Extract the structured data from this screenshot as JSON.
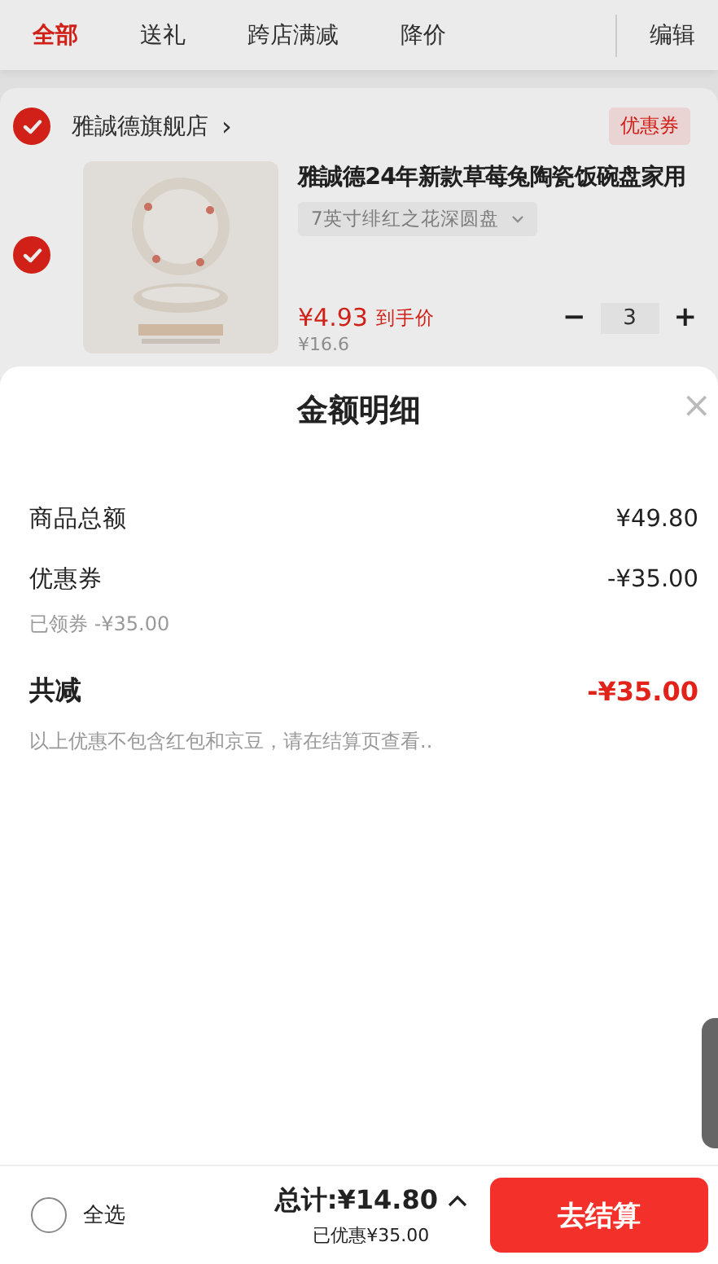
{
  "tabs": [
    {
      "label": "全部",
      "selected": true
    },
    {
      "label": "送礼",
      "selected": false
    },
    {
      "label": "跨店满减",
      "selected": false
    },
    {
      "label": "降价",
      "selected": false
    }
  ],
  "edit_button": "编辑",
  "store": {
    "name": "雅誠德旗舰店",
    "checked": true,
    "arrow": "›",
    "coupon_tag": "优惠券"
  },
  "item": {
    "checked": true,
    "title": "雅誠德24年新款草莓兔陶瓷饭碗盘家用",
    "variant": "7英寸绯红之花深圆盘",
    "price": "¥4.93",
    "price_note": "到手价",
    "original_price": "¥16.6",
    "quantity": "3",
    "minus": "−",
    "plus": "+"
  },
  "sheet": {
    "title": "金额明细",
    "close": "×",
    "rows": [
      {
        "kind": "line",
        "label": "商品总额",
        "value": "¥49.80"
      },
      {
        "kind": "line",
        "label": "优惠券",
        "value": "-¥35.00"
      },
      {
        "kind": "sub",
        "label": "已领券 -¥35.00"
      },
      {
        "kind": "total",
        "label": "共减",
        "value": "-¥35.00"
      },
      {
        "kind": "note",
        "label": "以上优惠不包含红包和京豆，请在结算页查看.."
      }
    ]
  },
  "footer": {
    "select_all": {
      "label": "全选",
      "checked": false
    },
    "total": "总计:¥14.80",
    "discount": "已优惠¥35.00",
    "checkout": "去结算"
  }
}
